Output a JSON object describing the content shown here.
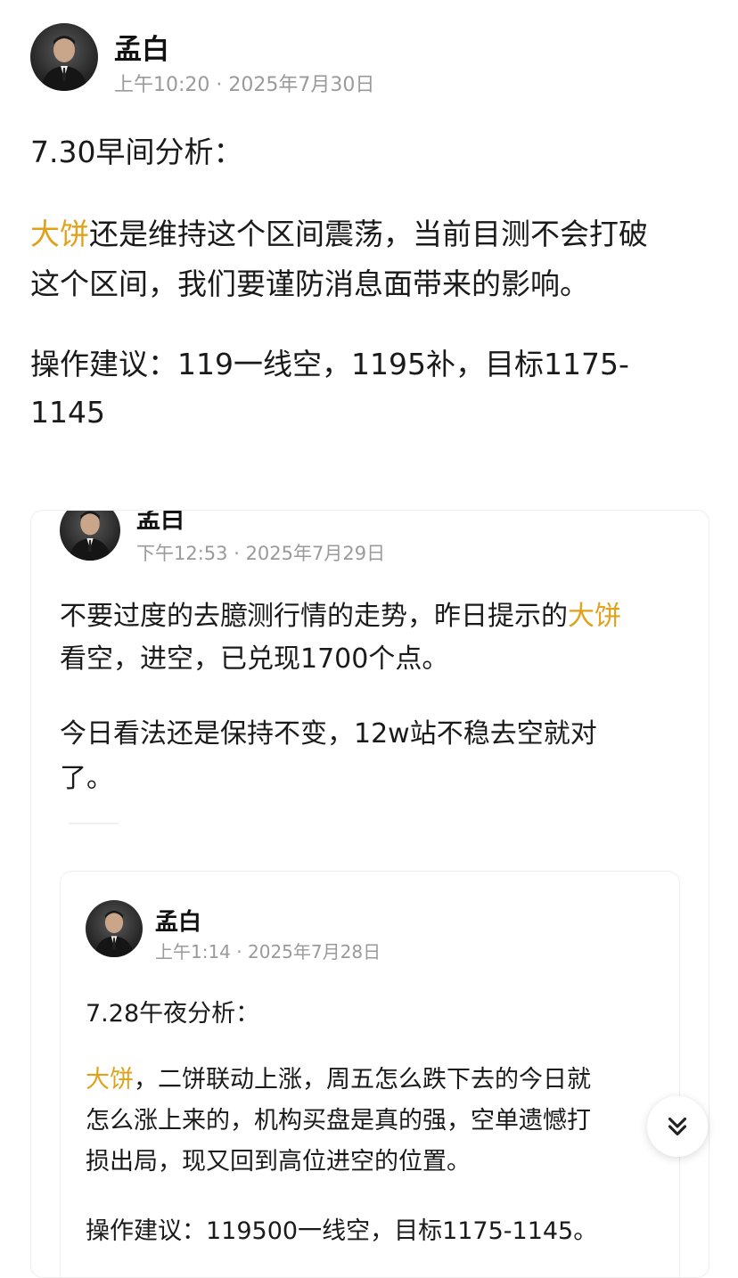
{
  "post": {
    "author": "孟白",
    "time": "上午10:20",
    "date_sep": " · ",
    "date": "2025年7月30日",
    "title": "7.30早间分析：",
    "p1_highlight": "大饼",
    "p1_line1_rest": "还是维持这个区间震荡，当前目测不会打破",
    "p1_line2": "这个区间，我们要谨防消息面带来的影响。",
    "p2_line1": "操作建议：119一线空，1195补，目标1175-",
    "p2_line2": "1145"
  },
  "quote1": {
    "author": "孟白",
    "time": "下午12:53",
    "date_sep": " · ",
    "date": "2025年7月29日",
    "p1_line1_pre": "不要过度的去臆测行情的走势，昨日提示的",
    "p1_highlight": "大饼",
    "p1_line2": "看空，进空，已兑现1700个点。",
    "p2_line1": "今日看法还是保持不变，12w站不稳去空就对",
    "p2_line2": "了。"
  },
  "quote2": {
    "author": "孟白",
    "time": "上午1:14",
    "date_sep": " · ",
    "date": "2025年7月28日",
    "title": "7.28午夜分析：",
    "p1_highlight": "大饼",
    "p1_line1_rest": "，二饼联动上涨，周五怎么跌下去的今日就",
    "p1_line2": "怎么涨上来的，机构买盘是真的强，空单遗憾打",
    "p1_line3": "损出局，现又回到高位进空的位置。",
    "p2_line1": "操作建议：119500一线空，目标1175-1145。"
  },
  "icons": {
    "avatar": "avatar-icon",
    "scroll": "double-chevron-down-icon"
  },
  "colors": {
    "highlight": "#e0a21a",
    "meta": "#9a9a9a",
    "text": "#1a1a1a"
  }
}
